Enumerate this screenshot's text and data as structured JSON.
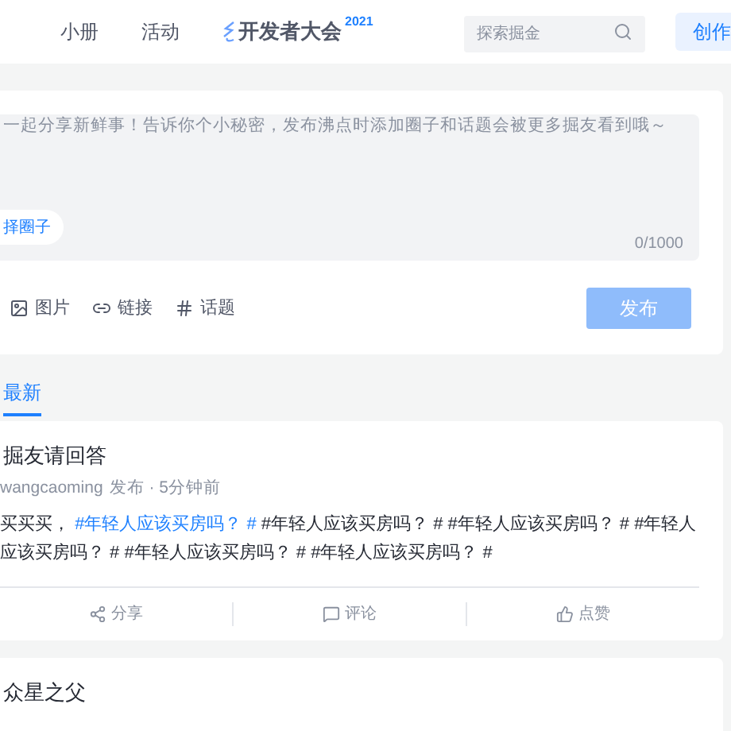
{
  "nav": {
    "items": [
      "小册",
      "活动"
    ],
    "logo_text": "开发者大会",
    "logo_badge": "2021",
    "search": {
      "placeholder": "探索掘金"
    },
    "create_button": "创作"
  },
  "composer": {
    "placeholder": "一起分享新鲜事！告诉你个小秘密，发布沸点时添加圈子和话题会被更多掘友看到哦～",
    "circle_button": "择圈子",
    "counter": "0/1000",
    "tools": [
      {
        "kind": "image",
        "label": "图片"
      },
      {
        "kind": "link",
        "label": "链接"
      },
      {
        "kind": "topic",
        "label": "话题"
      }
    ],
    "publish_button": "发布",
    "publish_disabled": true
  },
  "tabs": [
    {
      "label": "最新",
      "selected": true
    }
  ],
  "posts": [
    {
      "title": "掘友请回答",
      "author": "wangcaoming",
      "meta": "发布 · 5分钟前",
      "content": [
        {
          "kind": "text",
          "text": "买买买， "
        },
        {
          "kind": "topic",
          "text": "#年轻人应该买房吗？ #"
        },
        {
          "kind": "text",
          "text": " #年轻人应该买房吗？ # #年轻人应该买房吗？ # #年轻人应该买房吗？ # #年轻人应该买房吗？ # #年轻人应该买房吗？ #"
        }
      ],
      "actions": [
        {
          "kind": "share",
          "label": "分享"
        },
        {
          "kind": "comment",
          "label": "评论"
        },
        {
          "kind": "like",
          "label": "点赞"
        }
      ]
    },
    {
      "title": "众星之父"
    }
  ]
}
